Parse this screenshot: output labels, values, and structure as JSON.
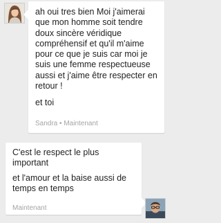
{
  "conversation": {
    "incoming": {
      "sender": "Sandra",
      "separator": "•",
      "time": "Maintenant",
      "paragraphs": [
        "ah  oui tres bien Moi j'aimerai que mon homme soit tendre doux sincère véridique compréhensif et qu'il m'aime pour ce que je suis car moi je suis une femme respectueuse aussi et j'aime être respecter en retour !",
        "et toi"
      ],
      "avatar_icon": "profile-photo-sandra"
    },
    "outgoing": {
      "time": "Maintenant",
      "paragraphs": [
        "C'est le respect le plus important",
        "et l'amour et la baise aussi de temps en temps"
      ],
      "avatar_icon": "profile-photo-self"
    }
  },
  "colors": {
    "background": "#ececec",
    "bubble": "#ffffff",
    "text": "#222222",
    "meta": "#a4a4a4"
  }
}
